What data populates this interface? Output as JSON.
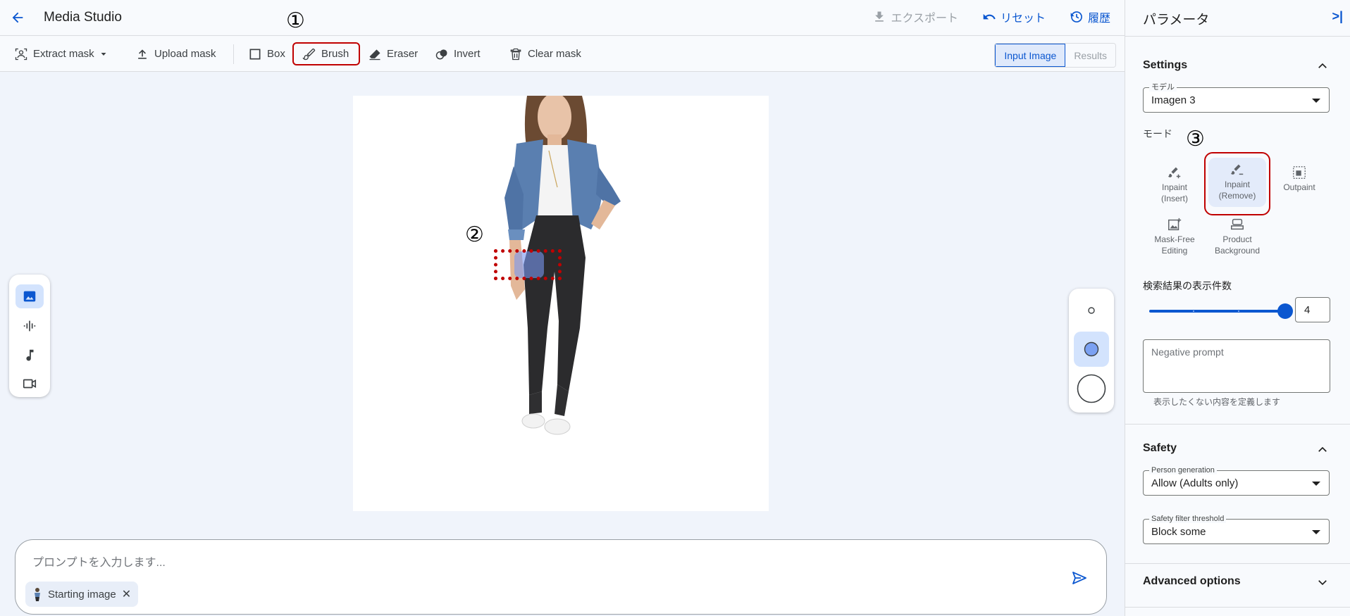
{
  "header": {
    "title": "Media Studio",
    "export_label": "エクスポート",
    "reset_label": "リセット",
    "history_label": "履歴"
  },
  "toolbar": {
    "extract_mask": "Extract mask",
    "upload_mask": "Upload mask",
    "box": "Box",
    "brush": "Brush",
    "eraser": "Eraser",
    "invert": "Invert",
    "clear_mask": "Clear mask",
    "view_input": "Input Image",
    "view_results": "Results"
  },
  "annotations": {
    "one": "①",
    "two": "②",
    "three": "③"
  },
  "prompt": {
    "placeholder": "プロンプトを入力します...",
    "chip_label": "Starting image"
  },
  "panel": {
    "title": "パラメータ",
    "settings": {
      "heading": "Settings",
      "model_label": "モデル",
      "model_value": "Imagen 3",
      "mode_label": "モード",
      "modes": [
        {
          "line1": "Inpaint",
          "line2": "(Insert)",
          "icon": "brush-plus-icon"
        },
        {
          "line1": "Inpaint",
          "line2": "(Remove)",
          "icon": "brush-minus-icon"
        },
        {
          "line1": "Outpaint",
          "line2": "",
          "icon": "outpaint-icon"
        },
        {
          "line1": "Mask-Free",
          "line2": "Editing",
          "icon": "image-edit-icon"
        },
        {
          "line1": "Product",
          "line2": "Background",
          "icon": "product-icon"
        }
      ],
      "selected_mode": "Inpaint (Remove)",
      "count_label": "検索結果の表示件数",
      "count_value": "4",
      "count_fraction": 1.0,
      "negative_placeholder": "Negative prompt",
      "negative_hint": "表示したくない内容を定義します"
    },
    "safety": {
      "heading": "Safety",
      "person_label": "Person generation",
      "person_value": "Allow (Adults only)",
      "filter_label": "Safety filter threshold",
      "filter_value": "Block some"
    },
    "advanced": {
      "heading": "Advanced options"
    }
  },
  "colors": {
    "accent": "#0b57d0",
    "highlight": "#c00000",
    "active_bg": "#d3e3fd"
  }
}
